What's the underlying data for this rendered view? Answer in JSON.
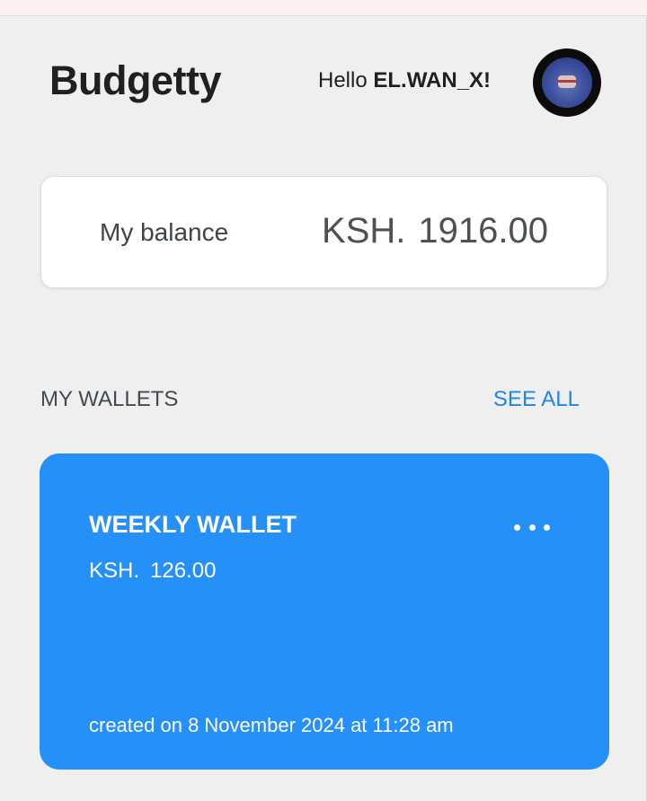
{
  "app": {
    "title": "Budgetty"
  },
  "header": {
    "greeting_prefix": "Hello",
    "username": "EL.WAN_X!"
  },
  "balance": {
    "label": "My balance",
    "currency": "KSH.",
    "amount": "1916.00"
  },
  "wallets_section": {
    "heading": "MY WALLETS",
    "see_all_label": "SEE ALL"
  },
  "wallets": [
    {
      "name": "WEEKLY WALLET",
      "currency": "KSH.",
      "amount": "126.00",
      "created_text": "created on 8 November 2024 at 11:28 am"
    }
  ],
  "icons": {
    "more": "more-horizontal-icon",
    "avatar": "user-avatar"
  },
  "colors": {
    "accent": "#1d86e8",
    "wallet_card": "#2590f8",
    "background": "#efefef"
  }
}
